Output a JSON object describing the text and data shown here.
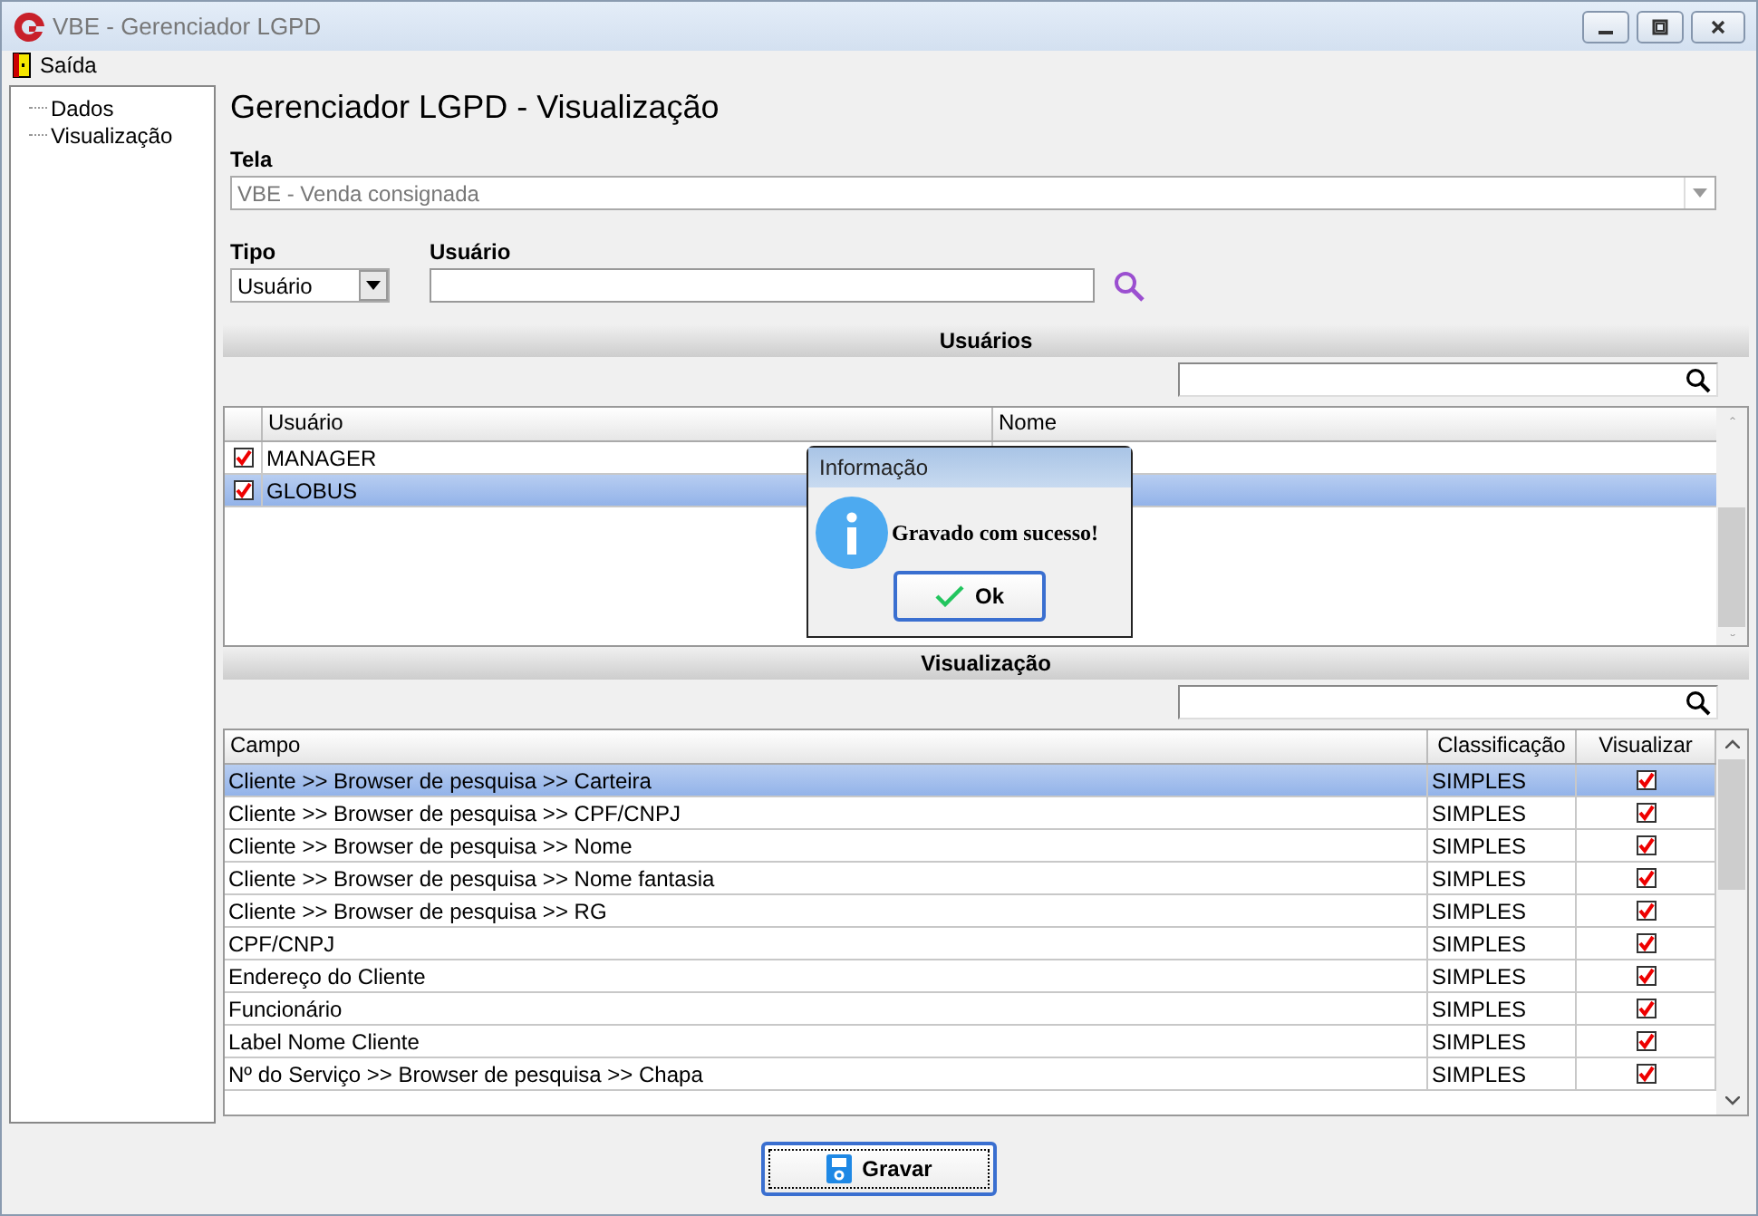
{
  "window": {
    "title": "VBE - Gerenciador LGPD"
  },
  "menu": [
    {
      "label": "Saída"
    }
  ],
  "tree": [
    {
      "label": "Dados"
    },
    {
      "label": "Visualização"
    }
  ],
  "heading": "Gerenciador LGPD - Visualização",
  "tela": {
    "label": "Tela",
    "value": "VBE - Venda consignada",
    "disabled": true
  },
  "tipo": {
    "label": "Tipo",
    "value": "Usuário"
  },
  "usuario": {
    "label": "Usuário"
  },
  "users_section": {
    "title": "Usuários",
    "columns": [
      "Usuário",
      "Nome"
    ],
    "rows": [
      {
        "usuario": "MANAGER",
        "checked": true,
        "selected": false
      },
      {
        "usuario": "GLOBUS",
        "checked": true,
        "selected": true
      }
    ]
  },
  "fields_section": {
    "title": "Visualização",
    "columns": [
      "Campo",
      "Classificação",
      "Visualizar"
    ],
    "rows": [
      {
        "campo": "Cliente >> Browser de pesquisa >> Carteira",
        "classificacao": "SIMPLES",
        "visualizar": true,
        "selected": true
      },
      {
        "campo": "Cliente >> Browser de pesquisa >> CPF/CNPJ",
        "classificacao": "SIMPLES",
        "visualizar": true,
        "selected": false
      },
      {
        "campo": "Cliente >> Browser de pesquisa >> Nome",
        "classificacao": "SIMPLES",
        "visualizar": true,
        "selected": false
      },
      {
        "campo": "Cliente >> Browser de pesquisa >> Nome fantasia",
        "classificacao": "SIMPLES",
        "visualizar": true,
        "selected": false
      },
      {
        "campo": "Cliente >> Browser de pesquisa >> RG",
        "classificacao": "SIMPLES",
        "visualizar": true,
        "selected": false
      },
      {
        "campo": "CPF/CNPJ",
        "classificacao": "SIMPLES",
        "visualizar": true,
        "selected": false
      },
      {
        "campo": "Endereço do Cliente",
        "classificacao": "SIMPLES",
        "visualizar": true,
        "selected": false
      },
      {
        "campo": "Funcionário",
        "classificacao": "SIMPLES",
        "visualizar": true,
        "selected": false
      },
      {
        "campo": "Label Nome Cliente",
        "classificacao": "SIMPLES",
        "visualizar": true,
        "selected": false
      },
      {
        "campo": "Nº do Serviço >> Browser de pesquisa >> Chapa",
        "classificacao": "SIMPLES",
        "visualizar": true,
        "selected": false
      }
    ]
  },
  "save_button": "Gravar",
  "dialog": {
    "title": "Informação",
    "message": "Gravado com sucesso!",
    "button": "Ok"
  }
}
